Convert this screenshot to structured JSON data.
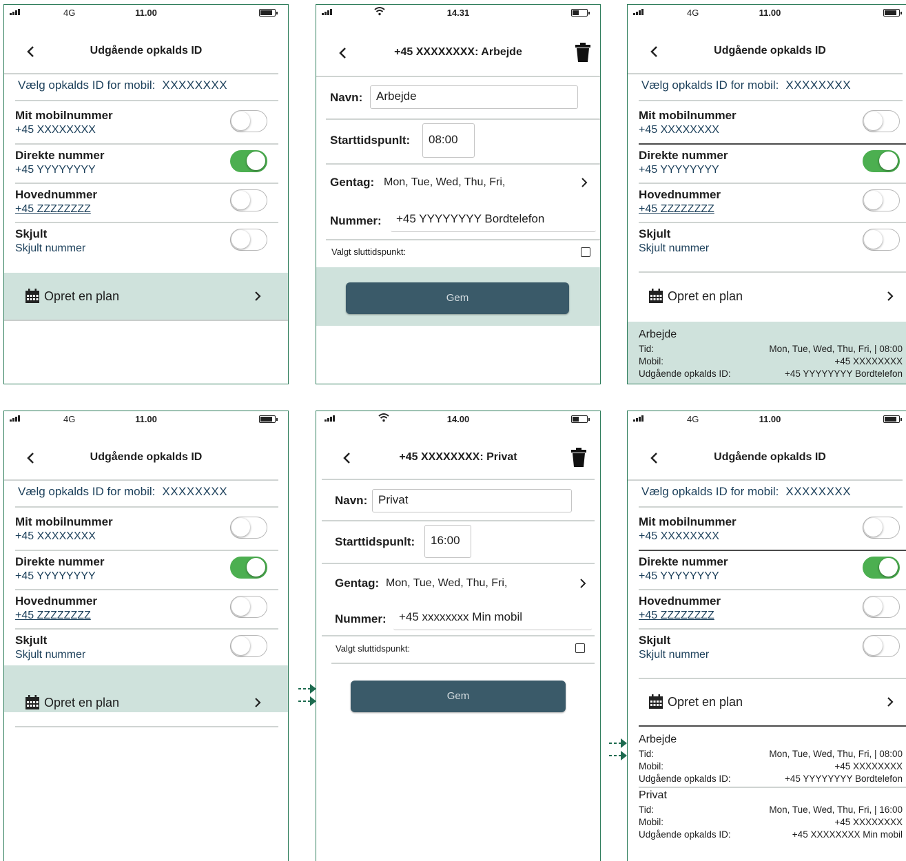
{
  "colors": {
    "frame": "#2e7d5b",
    "highlight": "#cfe2dc",
    "toggle_on": "#4caf50",
    "save_button": "#3a5a69",
    "text_blue": "#1b3f5a"
  },
  "icons": {
    "back": "chevron-left-icon",
    "trash": "trash-icon",
    "calendar": "calendar-icon",
    "chevron": "chevron-right-icon",
    "flow": "dashed-arrow-icon"
  },
  "list_screen": {
    "title": "Udgående opkalds ID",
    "select_label": "Vælg opkalds ID for mobil:",
    "select_value": "XXXXXXXX",
    "options": [
      {
        "name": "Mit mobilnummer",
        "number": "+45  XXXXXXXX",
        "on": false
      },
      {
        "name": "Direkte nummer",
        "number": "+45 YYYYYYYY",
        "on": true
      },
      {
        "name": "Hovednummer",
        "number": "+45 ZZZZZZZZ",
        "on": false
      },
      {
        "name": "Skjult",
        "number": "Skjult nummer",
        "on": false
      }
    ],
    "plan_label": "Opret en plan"
  },
  "screens": [
    {
      "status": {
        "network": "4G",
        "time": "11.00"
      }
    },
    {
      "status": {
        "time": "14.31"
      },
      "title": "+45 XXXXXXXX: Arbejde",
      "navn_label": "Navn:",
      "navn_value": "Arbejde",
      "start_label": "Starttidspunlt:",
      "start_value": "08:00",
      "gentag_label": "Gentag:",
      "gentag_value": "Mon, Tue, Wed, Thu, Fri,",
      "nummer_label": "Nummer:",
      "nummer_value": "+45 YYYYYYYY Bordtelefon",
      "slut_label": "Valgt sluttidspunkt:",
      "save_label": "Gem"
    },
    {
      "status": {
        "network": "4G",
        "time": "11.00"
      },
      "schedules": [
        {
          "name": "Arbejde",
          "tid_label": "Tid:",
          "tid_value": "Mon, Tue, Wed, Thu, Fri,  | 08:00",
          "mobil_label": "Mobil:",
          "mobil_value": "+45 XXXXXXXX",
          "id_label": "Udgående opkalds ID:",
          "id_value": "+45 YYYYYYYY Bordtelefon"
        }
      ]
    },
    {
      "status": {
        "network": "4G",
        "time": "11.00"
      }
    },
    {
      "status": {
        "time": "14.00"
      },
      "title": "+45  XXXXXXXX: Privat",
      "navn_label": "Navn:",
      "navn_value": "Privat",
      "start_label": "Starttidspunlt:",
      "start_value": "16:00",
      "gentag_label": "Gentag:",
      "gentag_value": "Mon, Tue, Wed, Thu, Fri,",
      "nummer_label": "Nummer:",
      "nummer_value": "+45  xxxxxxxx   Min mobil",
      "slut_label": "Valgt sluttidspunkt:",
      "save_label": "Gem"
    },
    {
      "status": {
        "network": "4G",
        "time": "11.00"
      },
      "schedules": [
        {
          "name": "Arbejde",
          "tid_label": "Tid:",
          "tid_value": "Mon, Tue, Wed, Thu, Fri,  | 08:00",
          "mobil_label": "Mobil:",
          "mobil_value": "+45 XXXXXXXX",
          "id_label": "Udgående opkalds ID:",
          "id_value": "+45 YYYYYYYY Bordtelefon"
        },
        {
          "name": "Privat",
          "tid_label": "Tid:",
          "tid_value": "Mon, Tue, Wed, Thu, Fri,  | 16:00",
          "mobil_label": "Mobil:",
          "mobil_value": "+45 XXXXXXXX",
          "id_label": "Udgående opkalds ID:",
          "id_value": "+45 XXXXXXXX  Min mobil"
        }
      ]
    }
  ]
}
